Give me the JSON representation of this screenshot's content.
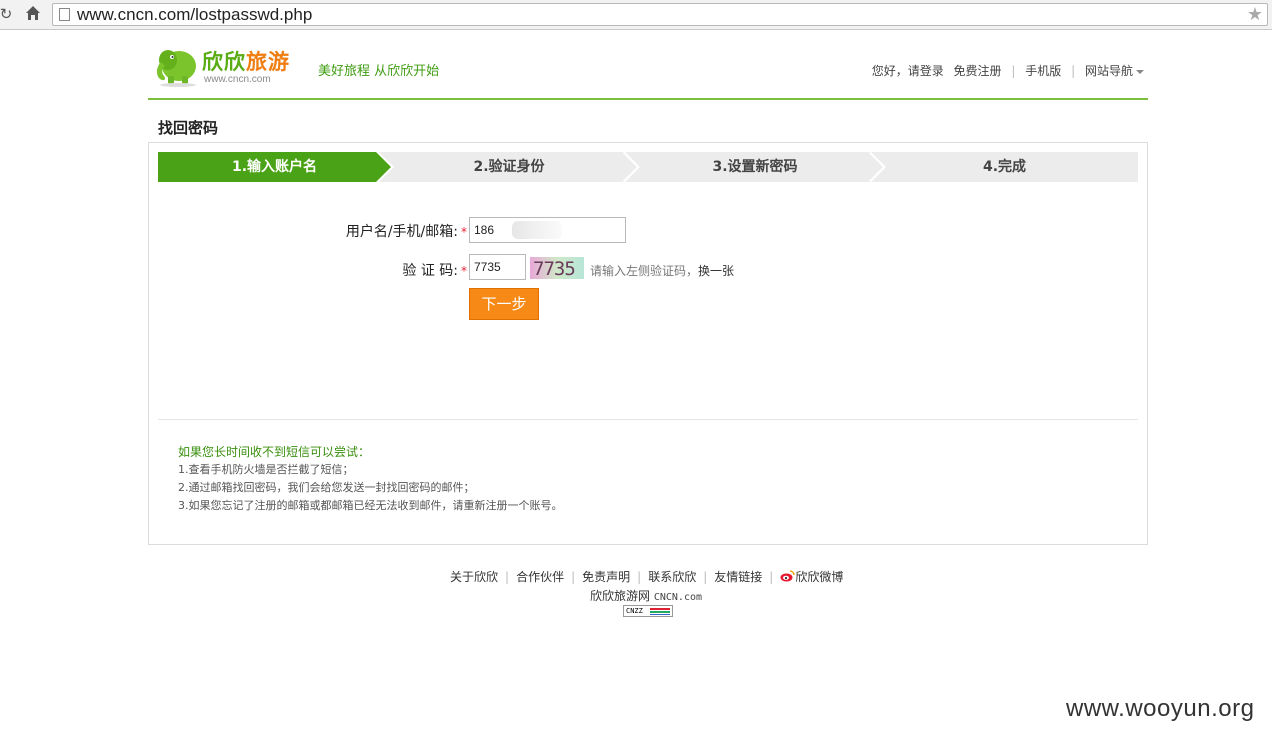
{
  "browser": {
    "url": "www.cncn.com/lostpasswd.php",
    "reload_icon": "reload-icon",
    "home_icon": "home-icon",
    "bookmark_icon": "star-icon"
  },
  "header": {
    "logo_text_a": "欣欣",
    "logo_text_b": "旅游",
    "logo_sub": "www.cncn.com",
    "slogan": "美好旅程 从欣欣开始",
    "greeting": "您好，",
    "login": "请登录",
    "register": "免费注册",
    "mobile": "手机版",
    "site_nav": "网站导航"
  },
  "page_title": "找回密码",
  "steps": [
    {
      "label": "1.输入账户名",
      "active": true
    },
    {
      "label": "2.验证身份",
      "active": false
    },
    {
      "label": "3.设置新密码",
      "active": false
    },
    {
      "label": "4.完成",
      "active": false
    }
  ],
  "form": {
    "account_label": "用户名/手机/邮箱:",
    "account_value": "186",
    "captcha_label": "验 证 码:",
    "captcha_value": "7735",
    "captcha_image_text": "7735",
    "captcha_hint": "请输入左侧验证码，",
    "captcha_change": "换一张",
    "required_mark": "*",
    "next_button": "下一步"
  },
  "tips": {
    "title": "如果您长时间收不到短信可以尝试：",
    "items": [
      "1.查看手机防火墙是否拦截了短信；",
      "2.通过邮箱找回密码，我们会给您发送一封找回密码的邮件；",
      "3.如果您忘记了注册的邮箱或都邮箱已经无法收到邮件，请重新注册一个账号。"
    ]
  },
  "footer": {
    "links": [
      "关于欣欣",
      "合作伙伴",
      "免责声明",
      "联系欣欣",
      "友情链接",
      "欣欣微博"
    ],
    "copyright_cn": "欣欣旅游网",
    "copyright_domain": "CNCN.com",
    "cnzz": "CNZZ"
  },
  "watermark": "www.wooyun.org",
  "colors": {
    "brand_green": "#5aac15",
    "step_active": "#4aa316",
    "button_orange": "#f78a17"
  }
}
